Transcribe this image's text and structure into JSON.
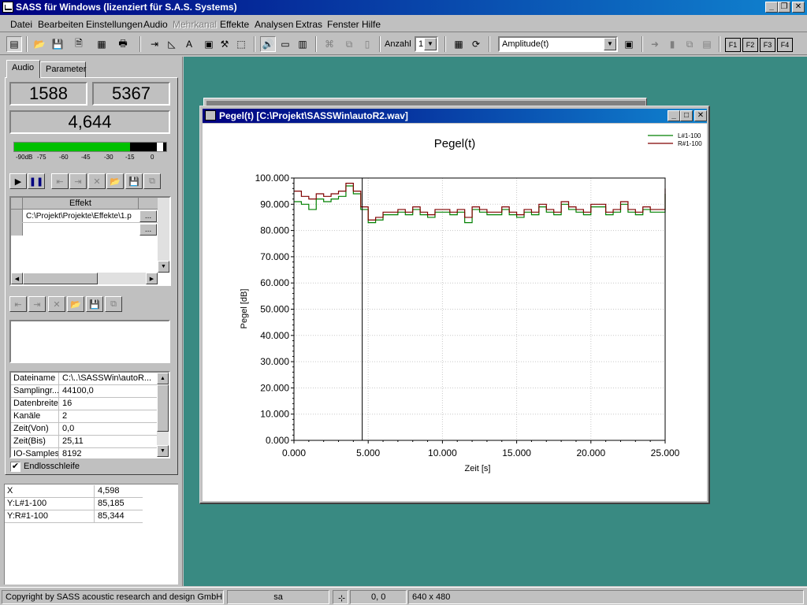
{
  "app": {
    "title": "SASS für Windows (lizenziert für S.A.S. Systems)",
    "controls": {
      "minimize": "_",
      "restore": "❐",
      "close": "✕"
    }
  },
  "menu": [
    "Datei",
    "Bearbeiten",
    "Einstellungen",
    "Audio",
    "Mehrkanal",
    "Effekte",
    "Analysen",
    "Extras",
    "Fenster",
    "Hilfe"
  ],
  "toolbar": {
    "anzahl_label": "Anzahl",
    "anzahl_value": "1",
    "mode_value": "Amplitude(t)",
    "fkeys": [
      "F1",
      "F2",
      "F3",
      "F4"
    ]
  },
  "left_panel": {
    "tabs": [
      "Audio",
      "Parameter"
    ],
    "counter_left": "1588",
    "counter_right": "5367",
    "big_value": "4,644",
    "meter": {
      "level_fraction": 0.76,
      "ticks": [
        "-90dB",
        "-75",
        "-60",
        "-45",
        "-30",
        "-15",
        "0"
      ]
    },
    "effects_table": {
      "header": "Effekt",
      "rows": [
        "C:\\Projekt\\Projekte\\Effekte\\1.p",
        ""
      ],
      "browse": "..."
    },
    "props": [
      {
        "key": "Dateiname",
        "value": "C:\\..\\SASSWin\\autoR..."
      },
      {
        "key": "Samplingr...",
        "value": "44100,0"
      },
      {
        "key": "Datenbreite",
        "value": "16"
      },
      {
        "key": "Kanäle",
        "value": "2"
      },
      {
        "key": "Zeit(Von)",
        "value": "0,0"
      },
      {
        "key": "Zeit(Bis)",
        "value": "25,11"
      },
      {
        "key": "IO-Samples",
        "value": "8192"
      }
    ],
    "loop_label": "Endlosschleife",
    "loop_checked": true
  },
  "cursor_table": [
    {
      "key": "X",
      "value": "4,598"
    },
    {
      "key": "Y:L#1-100",
      "value": "85,185"
    },
    {
      "key": "Y:R#1-100",
      "value": "85,344"
    }
  ],
  "child_window": {
    "title": "Pegel(t) [C:\\Projekt\\SASSWin\\autoR2.wav]"
  },
  "chart_data": {
    "type": "line",
    "title": "Pegel(t)",
    "xlabel": "Zeit [s]",
    "ylabel": "Pegel [dB]",
    "xlim": [
      0,
      25
    ],
    "ylim": [
      0,
      100
    ],
    "x_ticks": [
      "0.000",
      "5.000",
      "10.000",
      "15.000",
      "20.000",
      "25.000"
    ],
    "y_ticks": [
      "0.000",
      "10.000",
      "20.000",
      "30.000",
      "40.000",
      "50.000",
      "60.000",
      "70.000",
      "80.000",
      "90.000",
      "100.000"
    ],
    "grid": true,
    "legend_position": "top-right",
    "cursor_x": 4.598,
    "series": [
      {
        "name": "L#1-100",
        "color": "#008000",
        "x": [
          0,
          0.5,
          1,
          1.5,
          2,
          2.5,
          3,
          3.5,
          4,
          4.5,
          5,
          5.5,
          6,
          6.5,
          7,
          7.5,
          8,
          8.5,
          9,
          9.5,
          10,
          10.5,
          11,
          11.5,
          12,
          12.5,
          13,
          13.5,
          14,
          14.5,
          15,
          15.5,
          16,
          16.5,
          17,
          17.5,
          18,
          18.5,
          19,
          19.5,
          20,
          20.5,
          21,
          21.5,
          22,
          22.5,
          23,
          23.5,
          24,
          24.5,
          25
        ],
        "y": [
          91,
          90,
          88,
          92,
          91,
          92,
          93,
          97,
          94,
          88,
          83,
          84,
          86,
          86,
          87,
          86,
          88,
          86,
          85,
          87,
          87,
          86,
          87,
          83,
          88,
          87,
          86,
          86,
          88,
          86,
          85,
          87,
          86,
          89,
          87,
          86,
          90,
          88,
          87,
          86,
          89,
          89,
          86,
          87,
          90,
          87,
          86,
          88,
          87,
          87,
          94
        ]
      },
      {
        "name": "R#1-100",
        "color": "#800000",
        "x": [
          0,
          0.5,
          1,
          1.5,
          2,
          2.5,
          3,
          3.5,
          4,
          4.5,
          5,
          5.5,
          6,
          6.5,
          7,
          7.5,
          8,
          8.5,
          9,
          9.5,
          10,
          10.5,
          11,
          11.5,
          12,
          12.5,
          13,
          13.5,
          14,
          14.5,
          15,
          15.5,
          16,
          16.5,
          17,
          17.5,
          18,
          18.5,
          19,
          19.5,
          20,
          20.5,
          21,
          21.5,
          22,
          22.5,
          23,
          23.5,
          24,
          24.5,
          25
        ],
        "y": [
          95,
          93,
          92,
          94,
          93,
          94,
          95,
          98,
          95,
          89,
          84,
          85,
          87,
          87,
          88,
          87,
          89,
          87,
          86,
          88,
          88,
          87,
          88,
          85,
          89,
          88,
          87,
          87,
          89,
          87,
          86,
          88,
          87,
          90,
          88,
          87,
          91,
          89,
          88,
          87,
          90,
          90,
          87,
          88,
          91,
          88,
          87,
          89,
          88,
          88,
          96
        ]
      }
    ]
  },
  "status": {
    "copyright": "Copyright by SASS acoustic research and design GmbH",
    "user": "sa",
    "coords": "0, 0",
    "size": "640 x 480"
  },
  "colors": {
    "desktop": "#398a82",
    "title_bar": "#000080",
    "meter_green": "#00c000"
  }
}
